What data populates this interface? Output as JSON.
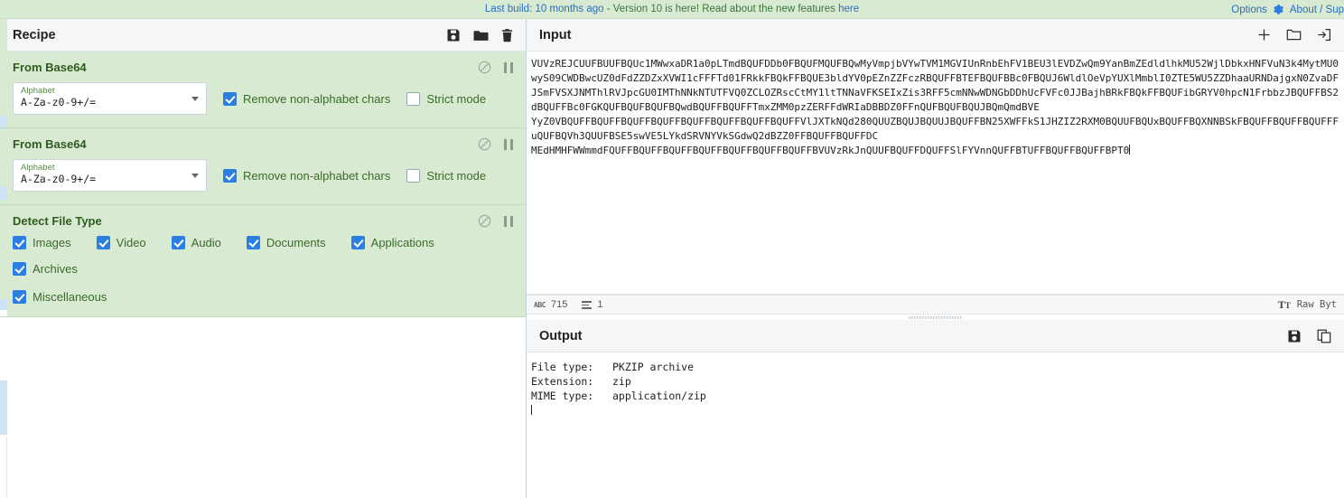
{
  "banner": {
    "last_build_link": "Last build: 10 months ago",
    "middle_text": " - Version 10 is here! Read about the new features ",
    "features_link": "here",
    "options_label": "Options",
    "options_icon": "gear-icon",
    "about_label": "About / Sup"
  },
  "recipe": {
    "title": "Recipe",
    "icons": [
      "save-icon",
      "folder-icon",
      "trash-icon"
    ],
    "operations": [
      {
        "name": "From Base64",
        "disable_icon": "disable-icon",
        "pause_icon": "pause-icon",
        "arg_label": "Alphabet",
        "arg_value": "A-Za-z0-9+/=",
        "checkboxes": [
          {
            "label": "Remove non-alphabet chars",
            "checked": true
          },
          {
            "label": "Strict mode",
            "checked": false
          }
        ]
      },
      {
        "name": "From Base64",
        "disable_icon": "disable-icon",
        "pause_icon": "pause-icon",
        "arg_label": "Alphabet",
        "arg_value": "A-Za-z0-9+/=",
        "checkboxes": [
          {
            "label": "Remove non-alphabet chars",
            "checked": true
          },
          {
            "label": "Strict mode",
            "checked": false
          }
        ]
      }
    ],
    "detect_file_type": {
      "name": "Detect File Type",
      "disable_icon": "disable-icon",
      "pause_icon": "pause-icon",
      "row1": [
        {
          "label": "Images",
          "checked": true
        },
        {
          "label": "Video",
          "checked": true
        },
        {
          "label": "Audio",
          "checked": true
        },
        {
          "label": "Documents",
          "checked": true
        },
        {
          "label": "Applications",
          "checked": true
        },
        {
          "label": "Archives",
          "checked": true
        }
      ],
      "row2": [
        {
          "label": "Miscellaneous",
          "checked": true
        }
      ]
    }
  },
  "input": {
    "title": "Input",
    "icons": [
      "add-tab-icon",
      "open-folder-icon",
      "open-file-icon"
    ],
    "value": "VUVzREJCUUFBUUFBQUc1MWwxaDR1a0pLTmdBQUFDDb0FBQUFMQUFBQwMyVmpjbVYwTVM1MGVIUnRnbEhFV1BEU3lEVDZwQm9YanBmZEdldlhkMU52WjlDbkxHNFVuN3k4MytMU0wyS09CWDBwcUZ0dFdZZDZxXVWI1cFFFTd01FRkkFBQkFFBQUE3bldYV0pEZnZZFczRBQUFFBTEFBQUFBBc0FBQUJ6WldlOeVpYUXlMmblI0ZTE5WU5ZZDhaaURNDajgxN0ZvaDFJSmFVSXJNMThlRVJpcGU0IMThNNkNTUTFVQ0ZCLOZRscCtMY1ltTNNaVFKSEIxZis3RFF5cmNNwWDNGbDDhUcFVFc0JJBajhBRkFBQkFFBQUFibGRYV0hpcN1FrbbzJBQUFFBS2dBQUFFBc0FGKQUFBQUFBQUFBQwdBQUFFBQUFFTmxZMM0pzZERFFdWRIaDBBDZ0FFnQUFBQUFBQUJBQmQmdBVE\nYyZ0VBQUFFBQUFFBQUFFBQUFFBQUFFBQUFFBQUFFBQUFFVlJXTkNQd280QUUZBQUJBQUUJBQUFFBN25XWFFkS1JHZIZ2RXM0BQUUFBQUxBQUFFBQXNNBSkFBQUFFBQUFFBQUFFFuQUFBQVh3QUUFBSE5swVE5LYkdSRVNYVkSGdwQ2dBZZ0FFBQUFFBQUFFDC\nMEdHMHFWWmmdFQUFFBQUFFBQUFFBQUFFBQUFFBQUFFBQUFFBVUVzRkJnQUUFBQUFFDQUFFSlFYVnnQUFFBTUFFBQUFFBQUFFBPT0"
  },
  "status": {
    "length_icon": "abc-icon",
    "length": "715",
    "lines_icon": "lines-icon",
    "lines": "1",
    "font_icon": "font-size-icon",
    "mode_label": "Raw Byt"
  },
  "output": {
    "title": "Output",
    "icons": [
      "save-icon",
      "copy-icon"
    ],
    "lines": [
      "File type:   PKZIP archive",
      "Extension:   zip",
      "MIME type:   application/zip"
    ]
  }
}
